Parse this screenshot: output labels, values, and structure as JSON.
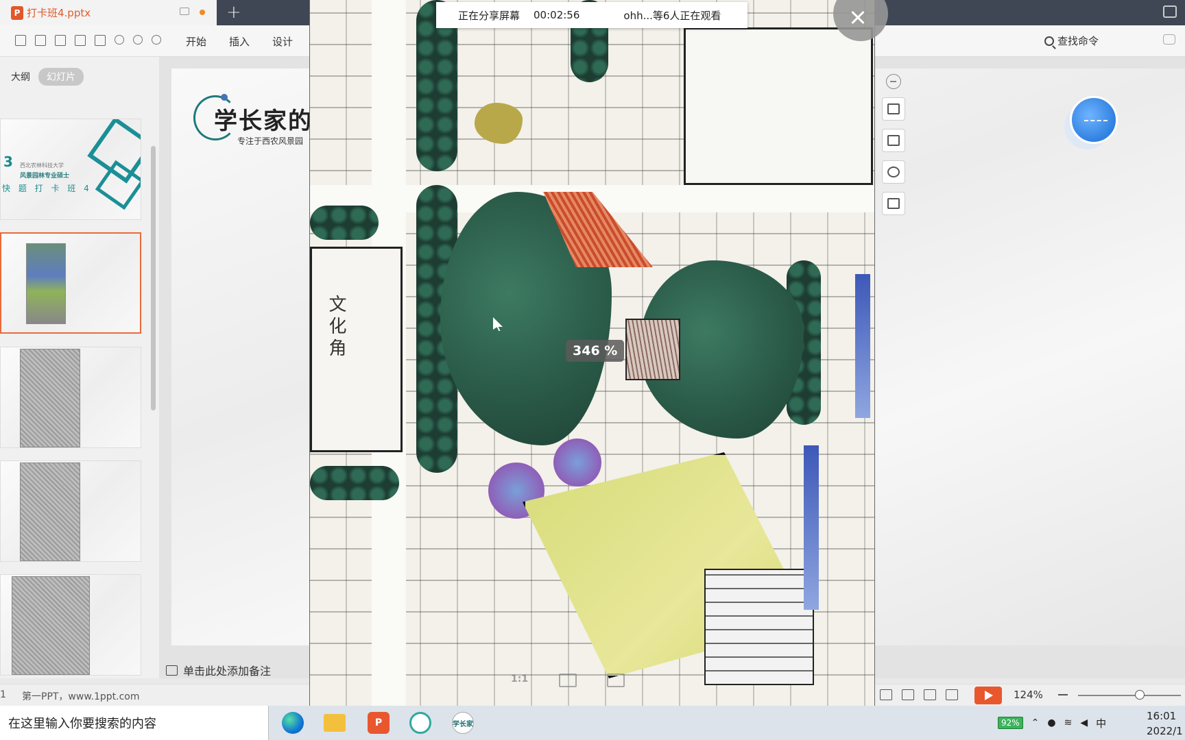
{
  "window": {
    "doc_tab_name": "打卡班4.pptx"
  },
  "ribbon": {
    "menu": [
      "开始",
      "插入",
      "设计"
    ],
    "command_search": "查找命令"
  },
  "left_panel": {
    "tab_outline": "大纲",
    "tab_slides": "幻灯片",
    "thumb1": {
      "number": "3",
      "line1": "西北农林科技大学",
      "line2": "风景园林专业硕士",
      "line3": "快 题 打 卡 班 4"
    }
  },
  "slide": {
    "logo_title": "学长家的",
    "logo_subtitle": "专注于西农风景园"
  },
  "notes_placeholder": "单击此处添加备注",
  "status_bar": {
    "slide_number": "1",
    "theme": "第一PPT，www.1ppt.com",
    "zoom": "124%"
  },
  "viewer": {
    "zoom_badge": "346 %",
    "share_status": "正在分享屏幕",
    "share_timer": "00:02:56",
    "watchers": "ohh...等6人正在观看",
    "ratio_label": "1:1",
    "plan_labels": [
      "文化角"
    ]
  },
  "taskbar": {
    "search_placeholder": "在这里输入你要搜索的内容",
    "battery": "92%",
    "ime": "中",
    "time": "16:01",
    "date": "2022/1"
  },
  "icons": {
    "ppt_logo": "P",
    "app_study": "学长家"
  }
}
